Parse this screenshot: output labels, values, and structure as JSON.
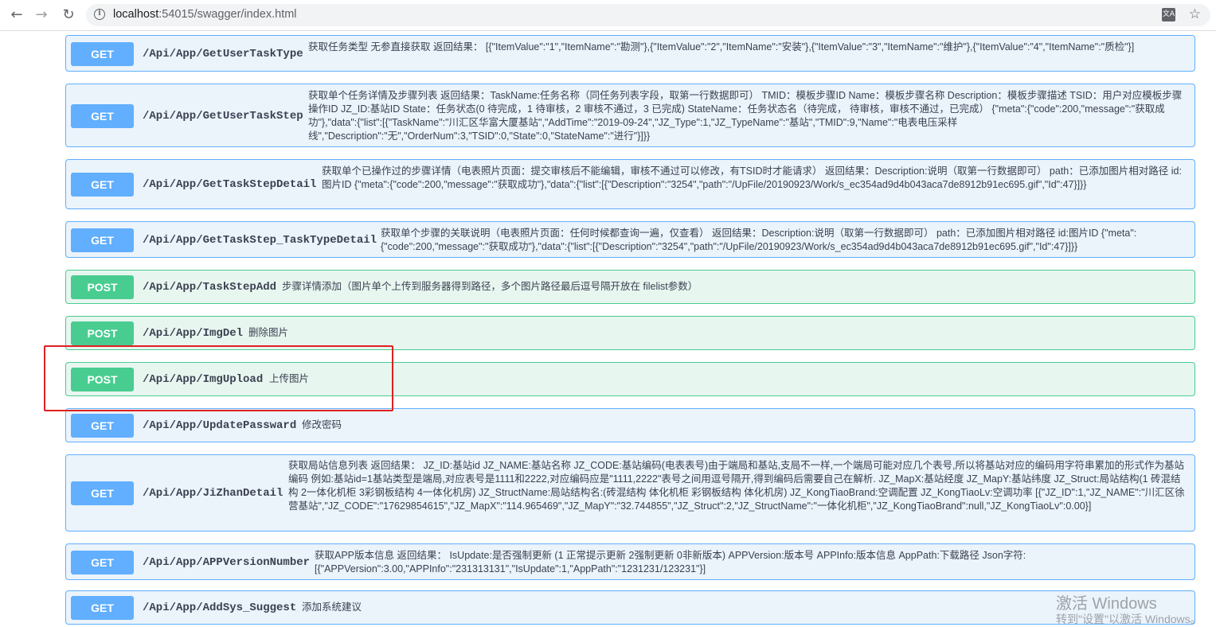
{
  "browser": {
    "url_host": "localhost",
    "url_rest": ":54015/swagger/index.html",
    "translate_glyph": "文A"
  },
  "operations": [
    {
      "method": "GET",
      "path": "/Api/App/GetUserTaskType",
      "description": "获取任务类型 无参直接获取 返回结果： [{\"ItemValue\":\"1\",\"ItemName\":\"勘测\"},{\"ItemValue\":\"2\",\"ItemName\":\"安装\"},{\"ItemValue\":\"3\",\"ItemName\":\"维护\"},{\"ItemValue\":\"4\",\"ItemName\":\"质检\"}]"
    },
    {
      "method": "GET",
      "path": "/Api/App/GetUserTaskStep",
      "description": "获取单个任务详情及步骤列表 返回结果：TaskName:任务名称（同任务列表字段，取第一行数据即可） TMID：模板步骤ID Name：模板步骤名称 Description：模板步骤描述 TSID：用户对应模板步骤操作ID JZ_ID:基站ID State：任务状态(0 待完成，1 待审核，2 审核不通过，3 已完成) StateName：任务状态名（待完成， 待审核，审核不通过，已完成） {\"meta\":{\"code\":200,\"message\":\"获取成功\"},\"data\":{\"list\":[{\"TaskName\":\"川汇区华富大厦基站\",\"AddTime\":\"2019-09-24\",\"JZ_Type\":1,\"JZ_TypeName\":\"基站\",\"TMID\":9,\"Name\":\"电表电压采样线\",\"Description\":\"无\",\"OrderNum\":3,\"TSID\":0,\"State\":0,\"StateName\":\"进行\"}]}}"
    },
    {
      "method": "GET",
      "path": "/Api/App/GetTaskStepDetail",
      "description": "获取单个已操作过的步骤详情（电表照片页面：提交审核后不能编辑，审核不通过可以修改，有TSID时才能请求） 返回结果：Description:说明（取第一行数据即可） path：已添加图片相对路径 id:图片ID {\"meta\":{\"code\":200,\"message\":\"获取成功\"},\"data\":{\"list\":[{\"Description\":\"3254\",\"path\":\"/UpFile/20190923/Work/s_ec354ad9d4b043aca7de8912b91ec695.gif\",\"Id\":47}]}}"
    },
    {
      "method": "GET",
      "path": "/Api/App/GetTaskStep_TaskTypeDetail",
      "description": "获取单个步骤的关联说明（电表照片页面：任何时候都查询一遍，仅查看） 返回结果：Description:说明（取第一行数据即可） path：已添加图片相对路径 id:图片ID {\"meta\":{\"code\":200,\"message\":\"获取成功\"},\"data\":{\"list\":[{\"Description\":\"3254\",\"path\":\"/UpFile/20190923/Work/s_ec354ad9d4b043aca7de8912b91ec695.gif\",\"Id\":47}]}}"
    },
    {
      "method": "POST",
      "path": "/Api/App/TaskStepAdd",
      "description": "步骤详情添加（图片单个上传到服务器得到路径，多个图片路径最后逗号隔开放在 filelist参数）"
    },
    {
      "method": "POST",
      "path": "/Api/App/ImgDel",
      "description": "删除图片"
    },
    {
      "method": "POST",
      "path": "/Api/App/ImgUpload",
      "description": "上传图片"
    },
    {
      "method": "GET",
      "path": "/Api/App/UpdatePassward",
      "description": "修改密码"
    },
    {
      "method": "GET",
      "path": "/Api/App/JiZhanDetail",
      "description": "获取局站信息列表 返回结果： JZ_ID:基站id JZ_NAME:基站名称 JZ_CODE:基站编码(电表表号)由于端局和基站,支局不一样,一个端局可能对应几个表号,所以将基站对应的编码用字符串累加的形式作为基站编码 例如:基站id=1基站类型是端局,对应表号是1111和2222,对应编码应是\"1111,2222\"表号之间用逗号隔开,得到编码后需要自己在解析. JZ_MapX:基站经度 JZ_MapY:基站纬度 JZ_Struct:局站结构(1 砖混结构 2一体化机柜 3彩钢板结构 4一体化机房) JZ_StructName:局站结构名:(砖混结构 体化机柜 彩钢板结构 体化机房) JZ_KongTiaoBrand:空调配置 JZ_KongTiaoLv:空调功率 [{\"JZ_ID\":1,\"JZ_NAME\":\"川汇区徐营基站\",\"JZ_CODE\":\"17629854615\",\"JZ_MapX\":\"114.965469\",\"JZ_MapY\":\"32.744855\",\"JZ_Struct\":2,\"JZ_StructName\":\"一体化机柜\",\"JZ_KongTiaoBrand\":null,\"JZ_KongTiaoLv\":0.00}]"
    },
    {
      "method": "GET",
      "path": "/Api/App/APPVersionNumber",
      "description": "获取APP版本信息 返回结果： IsUpdate:是否强制更新 (1 正常提示更新 2强制更新 0非新版本) APPVersion:版本号 APPInfo:版本信息 AppPath:下载路径 Json字符: [{\"APPVersion\":3.00,\"APPInfo\":\"231313131\",\"IsUpdate\":1,\"AppPath\":\"1231231/123231\"}]"
    },
    {
      "method": "GET",
      "path": "/Api/App/AddSys_Suggest",
      "description": "添加系统建议"
    }
  ],
  "watermark": {
    "title": "激活 Windows",
    "subtitle": "转到\"设置\"以激活 Windows。"
  }
}
